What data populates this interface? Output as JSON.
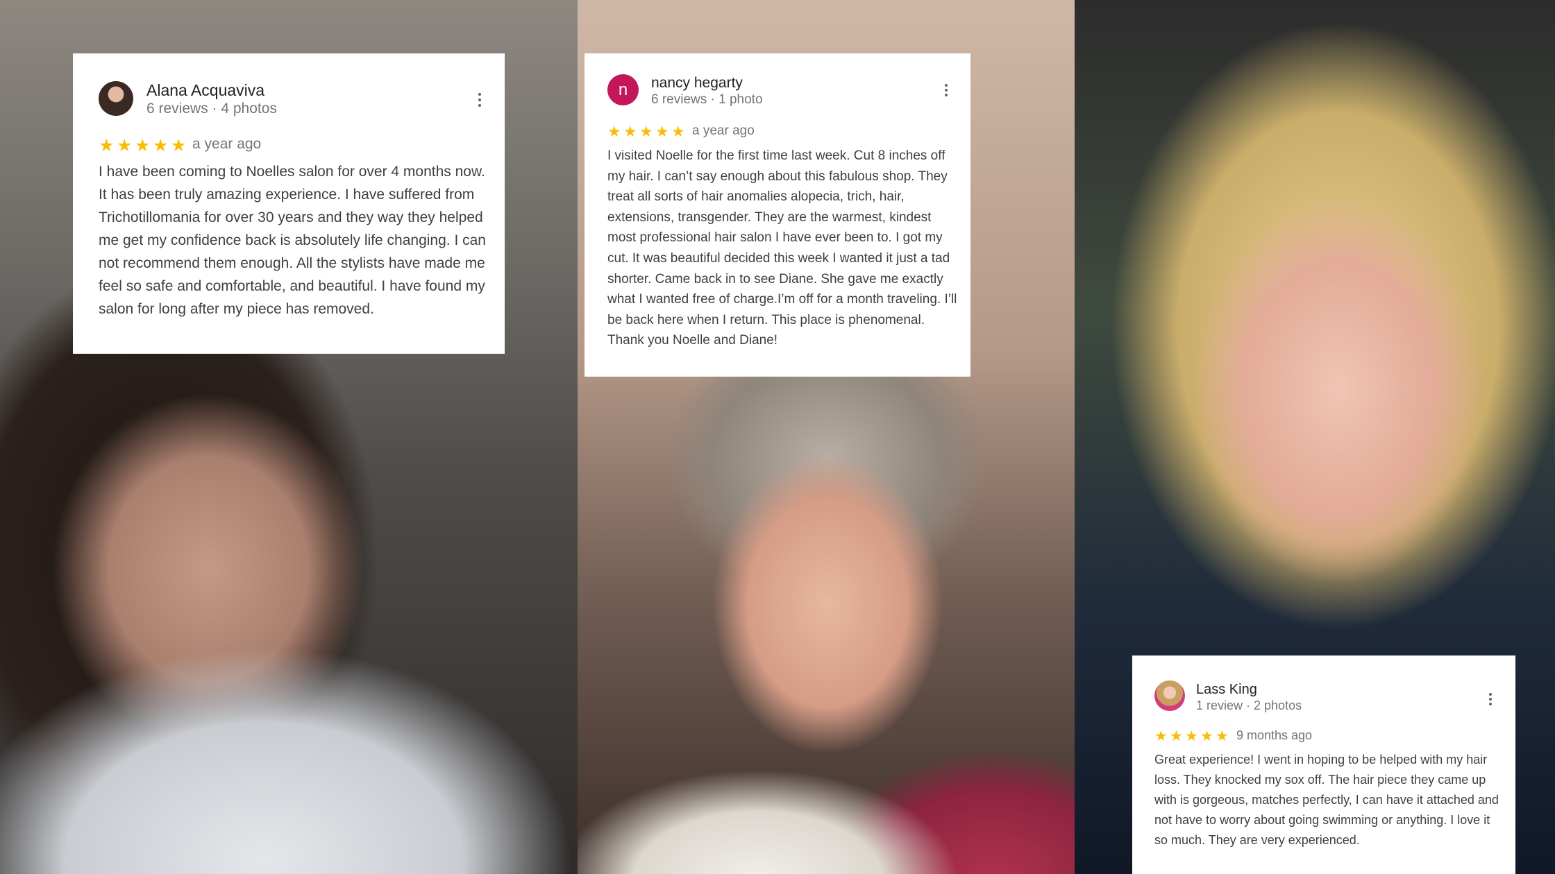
{
  "colors": {
    "star": "#fbbc04",
    "name_text": "#202124",
    "meta_text": "#70757a",
    "body_text": "#3c4043",
    "avatar_letter_bg": "#c2185b",
    "card_bg": "#ffffff"
  },
  "reviews": [
    {
      "name": "Alana Acquaviva",
      "meta": "6 reviews · 4 photos",
      "avatar": "profile-photo",
      "rating": 5,
      "time": "a year ago",
      "text": "I have been coming to Noelles salon for over 4 months now. It has been truly amazing experience. I have suffered from Trichotillomania for over 30 years and they way they helped me get my confidence back is absolutely life changing. I can not recommend them enough. All the stylists have made me feel so safe and comfortable, and beautiful. I have found my salon for long after my piece has removed."
    },
    {
      "name": "nancy hegarty",
      "meta": "6 reviews · 1 photo",
      "avatar_letter": "n",
      "rating": 5,
      "time": "a year ago",
      "text": "I visited Noelle for the first time last week. Cut 8 inches off my hair. I can’t say enough about this fabulous shop. They treat all sorts of hair anomalies alopecia, trich, hair, extensions, transgender. They are the warmest, kindest most professional hair salon I have ever been to. I got my cut. It was beautiful decided this week I wanted it just a tad shorter. Came back in to see Diane. She gave me exactly what I wanted free of charge.I’m  off for a month traveling. I’ll be back here when I return. This place is phenomenal. Thank you Noelle and Diane!"
    },
    {
      "name": "Lass King",
      "meta": "1 review · 2 photos",
      "avatar": "profile-photo",
      "rating": 5,
      "time": "9 months ago",
      "text": "Great experience! I went in hoping to be helped with my hair loss. They knocked my sox off. The hair piece they came up with is gorgeous, matches perfectly, I can have it attached and not have to worry about going swimming or anything. I love it so much. They are very experienced."
    }
  ],
  "icons": {
    "star": "★",
    "more": "more-vert-icon"
  }
}
